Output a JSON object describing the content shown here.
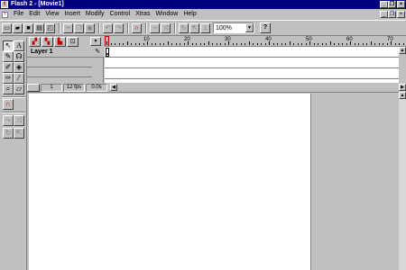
{
  "window": {
    "title": "Flash 2 - [Movie1]",
    "minimize_label": "_",
    "restore_label": "❐",
    "close_label": "×"
  },
  "menu": {
    "items": [
      "File",
      "Edit",
      "View",
      "Insert",
      "Modify",
      "Control",
      "Xtras",
      "Window",
      "Help"
    ]
  },
  "toolbar": {
    "zoom_value": "100%",
    "help_label": "?"
  },
  "timeline": {
    "layer_name": "Layer 1",
    "ruler_labels": [
      "10",
      "20",
      "30",
      "40",
      "50",
      "60",
      "70"
    ],
    "status": {
      "frame": "1",
      "fps": "12 fps",
      "time": "0.0s"
    }
  },
  "colors": {
    "titlebar": "#000080",
    "chrome": "#c0c0c0",
    "stage": "#ffffff",
    "accent_red": "#c00000"
  }
}
